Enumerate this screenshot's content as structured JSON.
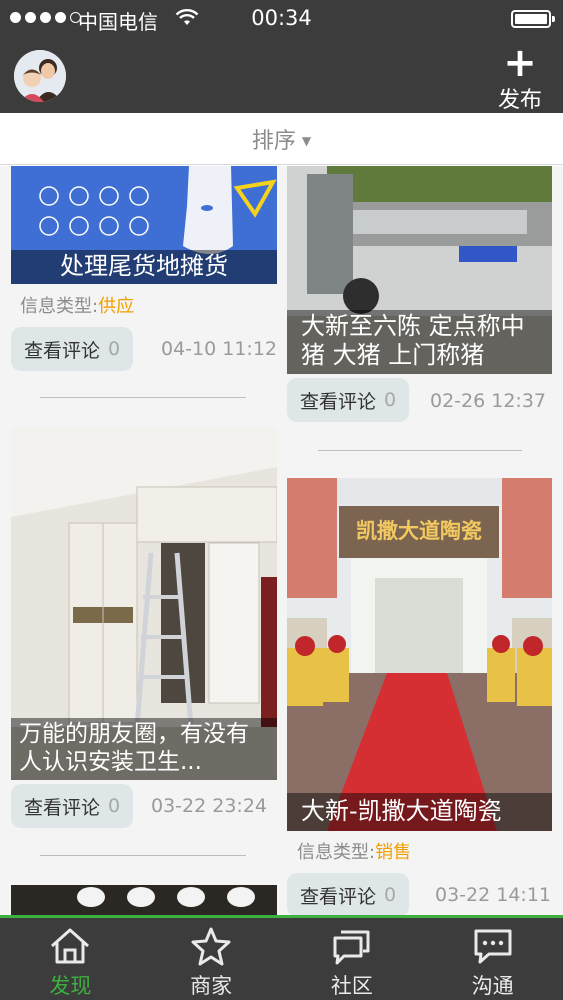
{
  "status_bar": {
    "carrier": "中国电信",
    "time": "00:34"
  },
  "header": {
    "publish_label": "发布"
  },
  "sort": {
    "label": "排序"
  },
  "posts": [
    {
      "title": "处理尾货地摊货",
      "info_label": "信息类型:",
      "info_value": "供应",
      "comment_label": "查看评论",
      "comment_count": "0",
      "date": "04-10 11:12"
    },
    {
      "title": "大新至六陈 定点称中猪 大猪 上门称猪",
      "comment_label": "查看评论",
      "comment_count": "0",
      "date": "02-26 12:37"
    },
    {
      "title": "万能的朋友圈，有没有人认识安装卫生...",
      "comment_label": "查看评论",
      "comment_count": "0",
      "date": "03-22 23:24"
    },
    {
      "title": "大新-凯撒大道陶瓷",
      "image_sign": "凯撒大道陶瓷",
      "info_label": "信息类型:",
      "info_value": "销售",
      "comment_label": "查看评论",
      "comment_count": "0",
      "date": "03-22 14:11"
    }
  ],
  "tabs": [
    {
      "label": "发现",
      "icon": "home-icon"
    },
    {
      "label": "商家",
      "icon": "star-icon"
    },
    {
      "label": "社区",
      "icon": "community-icon"
    },
    {
      "label": "沟通",
      "icon": "chat-icon"
    }
  ],
  "colors": {
    "bar_bg": "#3c3c3c",
    "accent_green": "#3db041",
    "info_orange": "#f0a000"
  }
}
